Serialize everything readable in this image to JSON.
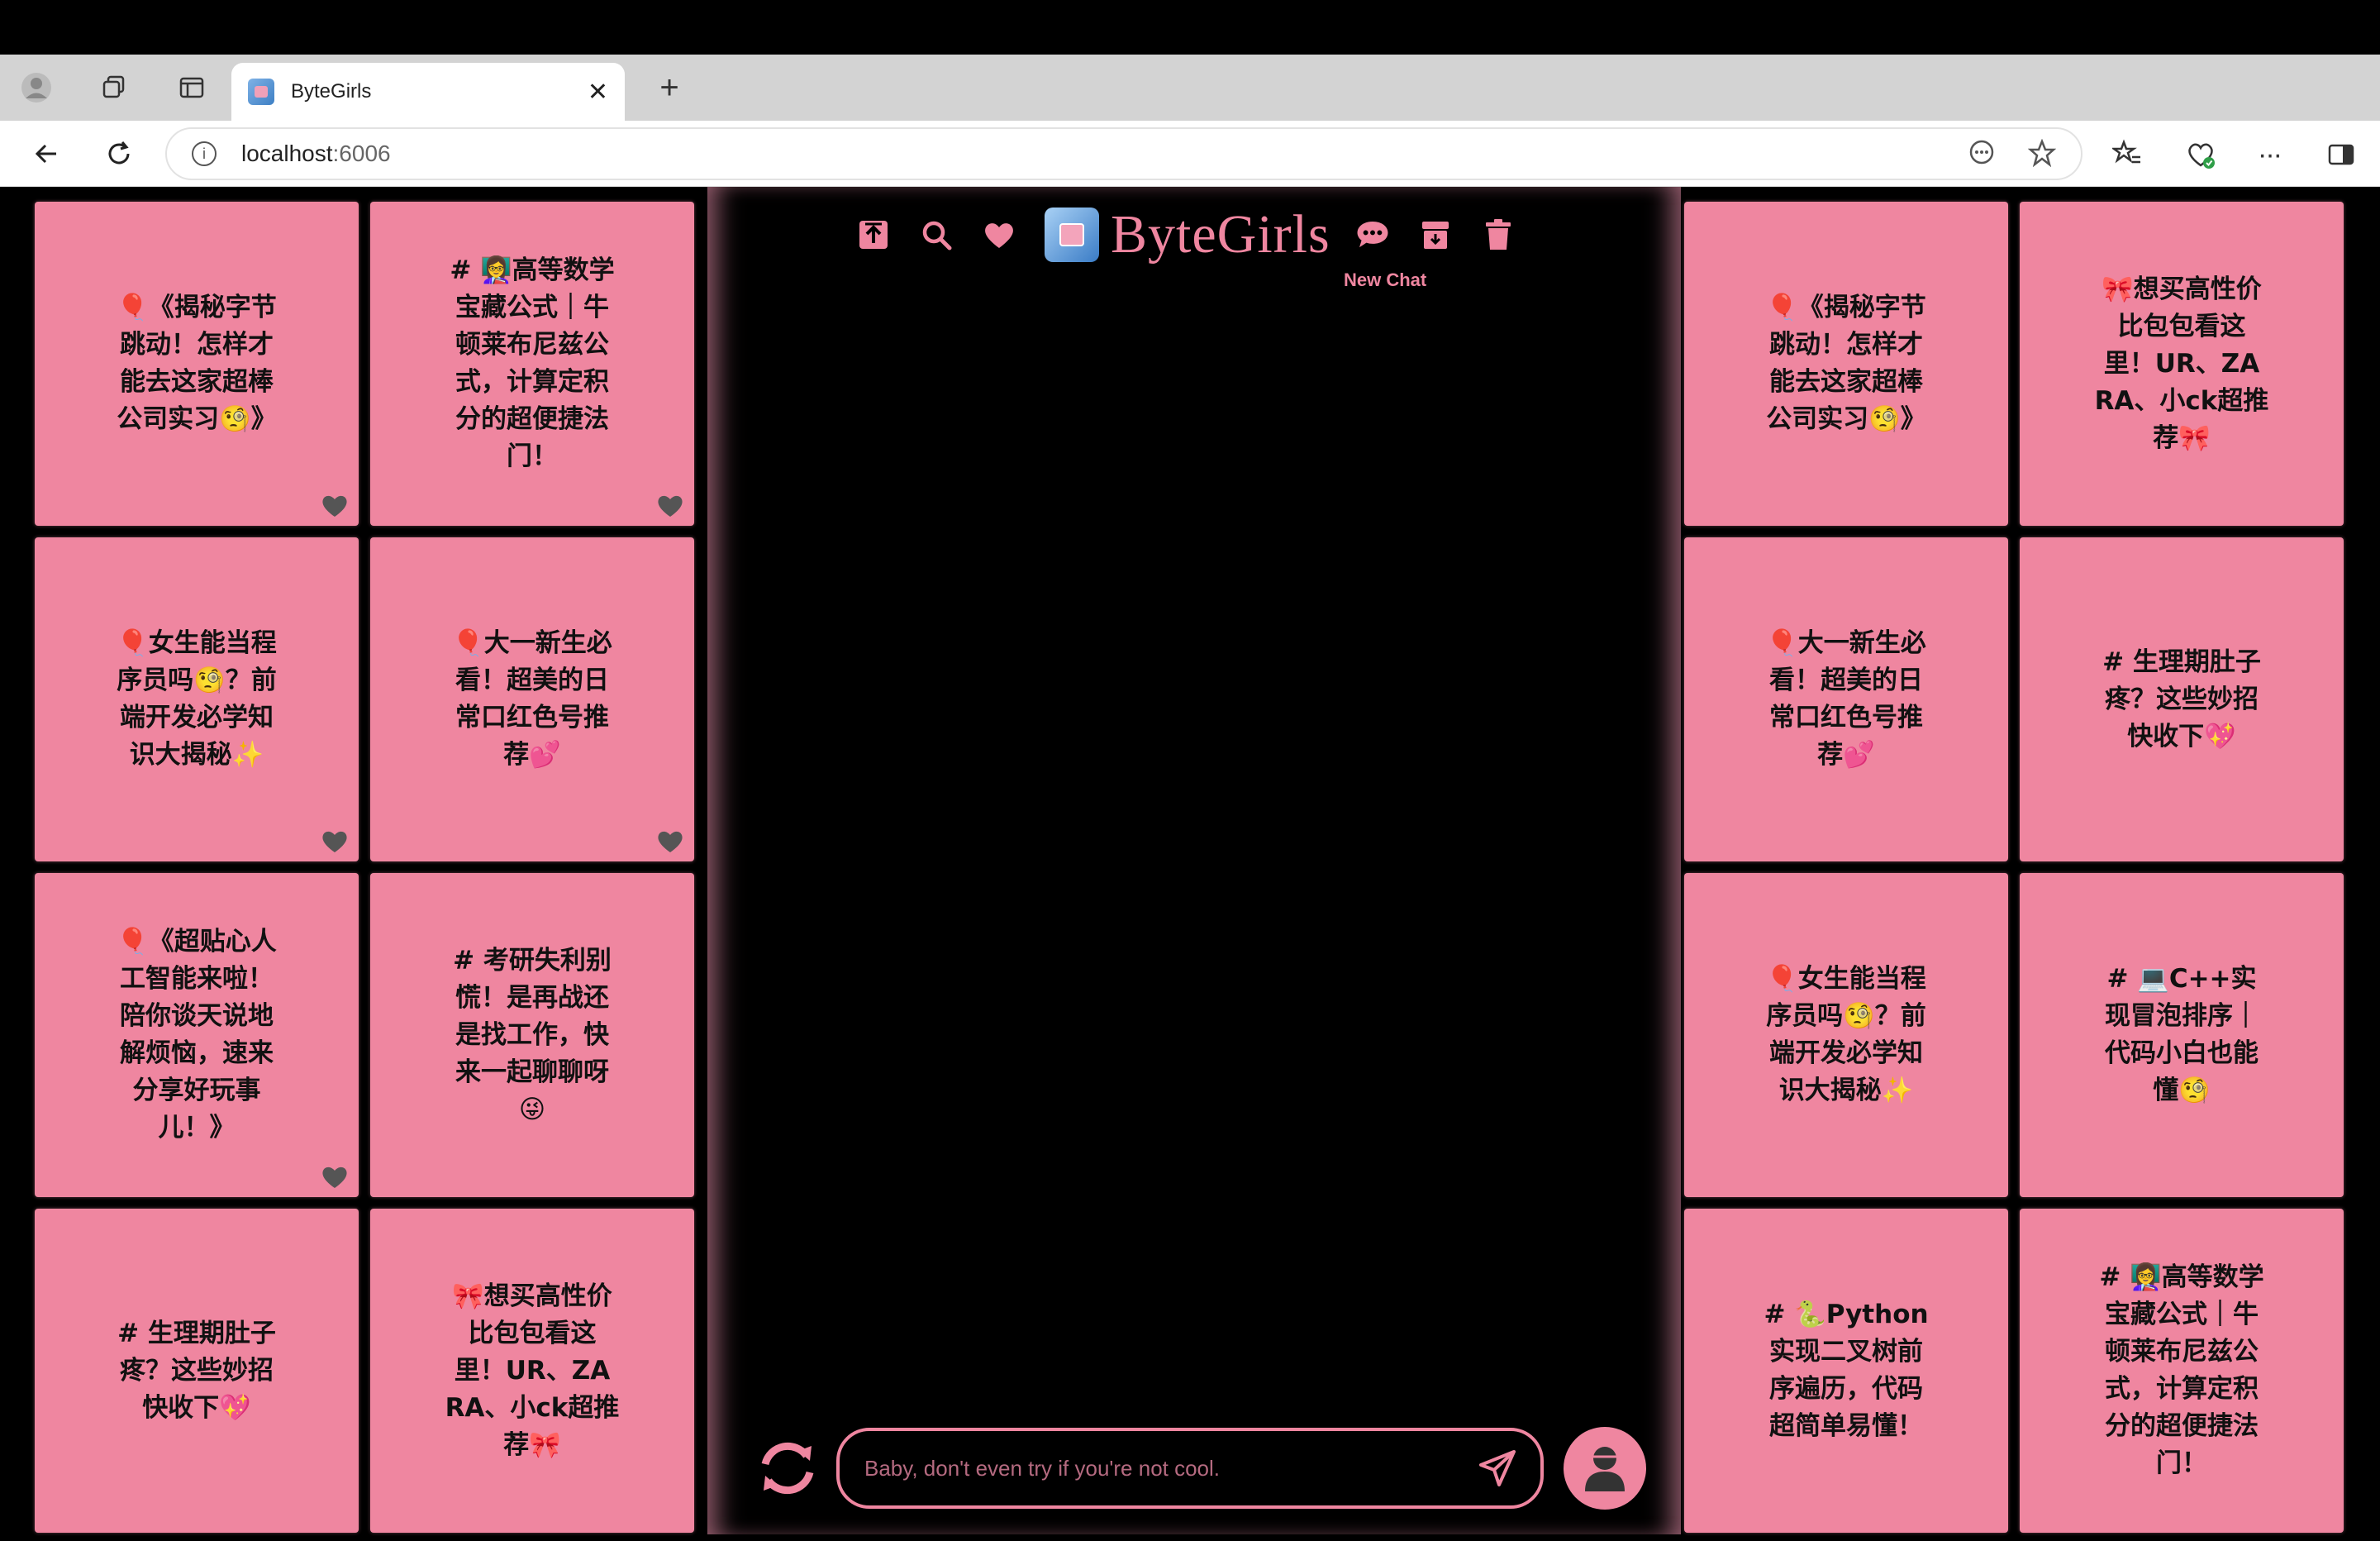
{
  "browser": {
    "tab_title": "ByteGirls",
    "url_host": "localhost",
    "url_port": ":6006"
  },
  "header": {
    "brand": "ByteGirls",
    "new_chat_label": "New Chat"
  },
  "chat": {
    "placeholder": "Baby, don't even try if you're not cool."
  },
  "left_cards": [
    {
      "text": "🎈《揭秘字节跳动！怎样才能去这家超棒公司实习🧐》",
      "liked": true
    },
    {
      "text": "# 👩‍🏫高等数学宝藏公式｜牛顿莱布尼兹公式，计算定积分的超便捷法门！",
      "liked": true
    },
    {
      "text": "🎈女生能当程序员吗🧐？前端开发必学知识大揭秘✨",
      "liked": true
    },
    {
      "text": "🎈大一新生必看！超美的日常口红色号推荐💕",
      "liked": true
    },
    {
      "text": "🎈《超贴心人工智能来啦！陪你谈天说地解烦恼，速来分享好玩事儿！》",
      "liked": true
    },
    {
      "text": "# 考研失利别慌！是再战还是找工作，快来一起聊聊呀😜",
      "liked": false
    },
    {
      "text": "# 生理期肚子疼？这些妙招快收下💖",
      "liked": false
    },
    {
      "text": "🎀想买高性价比包包看这里！UR、ZARA、小ck超推荐🎀",
      "liked": false
    }
  ],
  "right_cards": [
    {
      "text": "🎈《揭秘字节跳动！怎样才能去这家超棒公司实习🧐》"
    },
    {
      "text": "🎀想买高性价比包包看这里！UR、ZARA、小ck超推荐🎀"
    },
    {
      "text": "🎈大一新生必看！超美的日常口红色号推荐💕"
    },
    {
      "text": "# 生理期肚子疼？这些妙招快收下💖"
    },
    {
      "text": "🎈女生能当程序员吗🧐？前端开发必学知识大揭秘✨"
    },
    {
      "text": "# 💻C++实现冒泡排序｜代码小白也能懂🧐"
    },
    {
      "text": "# 🐍Python实现二叉树前序遍历，代码超简单易懂！"
    },
    {
      "text": "# 👩‍🏫高等数学宝藏公式｜牛顿莱布尼兹公式，计算定积分的超便捷法门！"
    }
  ],
  "colors": {
    "accent_pink": "#ef86a0",
    "background": "#000000",
    "heart": "#555555"
  }
}
